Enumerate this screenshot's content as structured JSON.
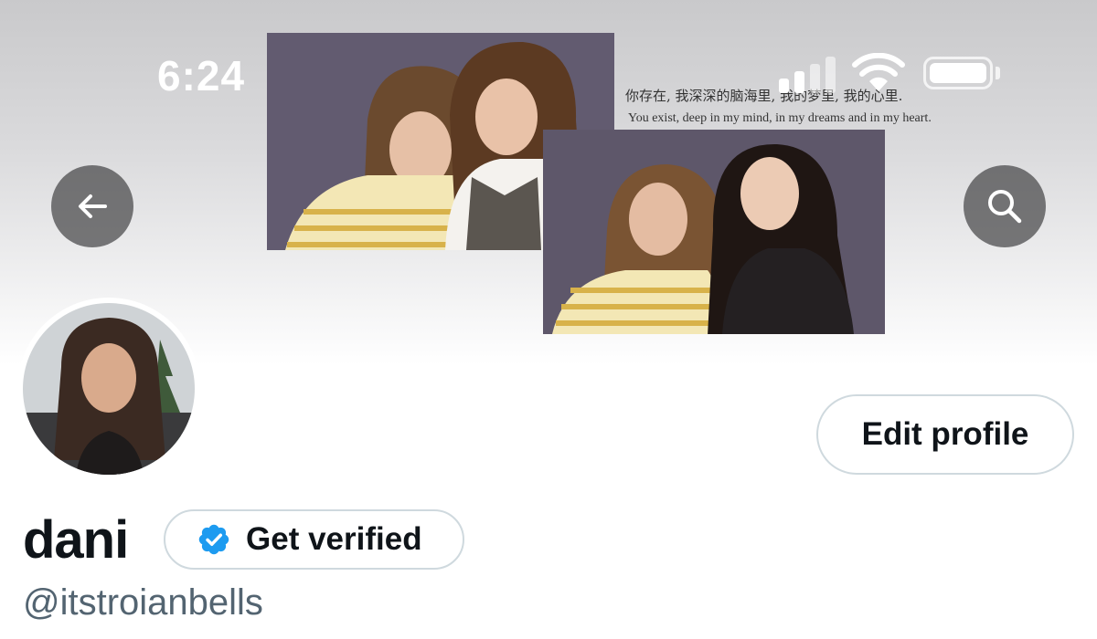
{
  "status_bar": {
    "time": "6:24"
  },
  "nav": {
    "back_icon": "arrow-left-icon",
    "search_icon": "search-icon"
  },
  "banner": {
    "caption_zh": "你存在, 我深深的脑海里, 我的梦里, 我的心里.",
    "caption_en": "You exist, deep in my mind, in my dreams and in my heart."
  },
  "profile": {
    "display_name": "dani",
    "handle": "@itstroianbells",
    "edit_label": "Edit profile",
    "verify_label": "Get verified"
  },
  "colors": {
    "verified_badge": "#1d9bf0",
    "text_primary": "#0f1419",
    "text_secondary": "#536471",
    "border": "#cfd9de"
  }
}
